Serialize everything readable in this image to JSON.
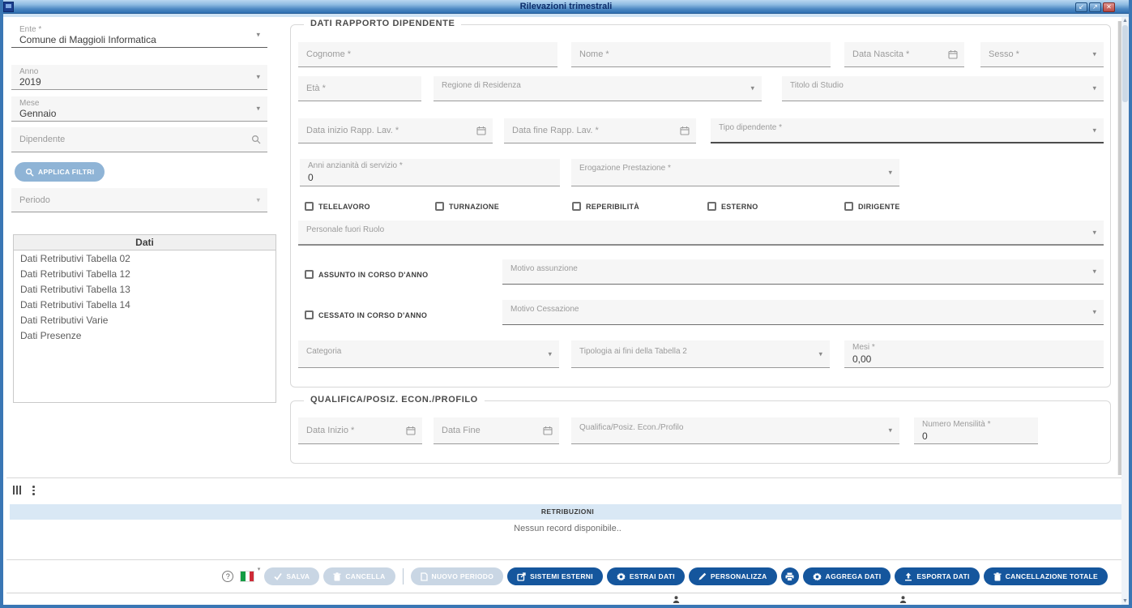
{
  "icons": {
    "minimize": "↙",
    "restore": "↗",
    "close": "✕",
    "dropdown": "▾",
    "scroll_up": "▲",
    "scroll_down": "▼"
  },
  "window": {
    "title": "Rilevazioni trimestrali"
  },
  "sidebar": {
    "ente": {
      "label": "Ente *",
      "value": "Comune di Maggioli Informatica"
    },
    "anno": {
      "label": "Anno",
      "value": "2019"
    },
    "mese": {
      "label": "Mese",
      "value": "Gennaio"
    },
    "dipendente": {
      "label": "Dipendente"
    },
    "applica_filtri": {
      "label": "APPLICA FILTRI"
    },
    "periodo": {
      "label": "Periodo"
    },
    "dati": {
      "header": "Dati",
      "items": [
        "Dati Retributivi Tabella 02",
        "Dati Retributivi Tabella 12",
        "Dati Retributivi Tabella 13",
        "Dati Retributivi Tabella 14",
        "Dati Retributivi Varie",
        "Dati Presenze"
      ]
    }
  },
  "rapporto": {
    "legend": "DATI RAPPORTO DIPENDENTE",
    "cognome": {
      "label": "Cognome *"
    },
    "nome": {
      "label": "Nome *"
    },
    "data_nascita": {
      "label": "Data Nascita *"
    },
    "sesso": {
      "label": "Sesso *"
    },
    "eta": {
      "label": "Età *"
    },
    "regione_residenza": {
      "label": "Regione di Residenza"
    },
    "titolo_studio": {
      "label": "Titolo di Studio"
    },
    "data_inizio_rapp": {
      "label": "Data inizio Rapp. Lav. *"
    },
    "data_fine_rapp": {
      "label": "Data fine Rapp. Lav. *"
    },
    "tipo_dipendente": {
      "label": "Tipo dipendente *"
    },
    "anni_anzianita": {
      "label": "Anni anzianità di servizio *",
      "value": "0"
    },
    "erogazione": {
      "label": "Erogazione Prestazione *"
    },
    "flags": [
      "TELELAVORO",
      "TURNAZIONE",
      "REPERIBILITÀ",
      "ESTERNO",
      "DIRIGENTE"
    ],
    "personale_fuori_ruolo": {
      "label": "Personale fuori Ruolo"
    },
    "assunto": {
      "label": "ASSUNTO IN CORSO D'ANNO"
    },
    "motivo_assunzione": {
      "label": "Motivo assunzione"
    },
    "cessato": {
      "label": "CESSATO IN CORSO D'ANNO"
    },
    "motivo_cessazione": {
      "label": "Motivo Cessazione"
    },
    "categoria": {
      "label": "Categoria"
    },
    "tipologia_tabella": {
      "label": "Tipologia ai fini della Tabella 2"
    },
    "mesi": {
      "label": "Mesi *",
      "value": "0,00"
    }
  },
  "qualifica": {
    "legend": "QUALIFICA/POSIZ. ECON./PROFILO",
    "data_inizio": {
      "label": "Data Inizio *"
    },
    "data_fine": {
      "label": "Data Fine"
    },
    "profilo": {
      "label": "Qualifica/Posiz. Econ./Profilo"
    },
    "numero_mensilita": {
      "label": "Numero Mensilità *",
      "value": "0"
    }
  },
  "grid": {
    "header": "RETRIBUZIONI",
    "empty_text": "Nessun record disponibile.."
  },
  "toolbar": {
    "help": "?",
    "salva": {
      "label": "SALVA",
      "icon": "check-icon"
    },
    "cancella": {
      "label": "CANCELLA",
      "icon": "trash-icon"
    },
    "nuovo_periodo": {
      "label": "NUOVO PERIODO",
      "icon": "document-icon"
    },
    "sistemi_esterni": {
      "label": "SISTEMI ESTERNI",
      "icon": "external-icon"
    },
    "estrai_dati": {
      "label": "ESTRAI DATI",
      "icon": "gear-icon"
    },
    "personalizza": {
      "label": "PERSONALIZZA",
      "icon": "pencil-icon"
    },
    "stampa": {
      "icon": "printer-icon"
    },
    "aggrega_dati": {
      "label": "AGGREGA DATI",
      "icon": "gear-icon"
    },
    "esporta_dati": {
      "label": "ESPORTA DATI",
      "icon": "upload-icon"
    },
    "cancellazione_totale": {
      "label": "CANCELLAZIONE TOTALE",
      "icon": "trash-icon"
    }
  },
  "colors": {
    "accent_blue": "#15569d",
    "disabled_button": "#c9d6e4",
    "titlebar_top": "#b9d8f0",
    "titlebar_bottom": "#2f6fb2",
    "grid_header_bg": "#d9e8f5",
    "filter_button": "#8fb4d6",
    "flag_green": "#149b44",
    "flag_red": "#ce2b37"
  }
}
